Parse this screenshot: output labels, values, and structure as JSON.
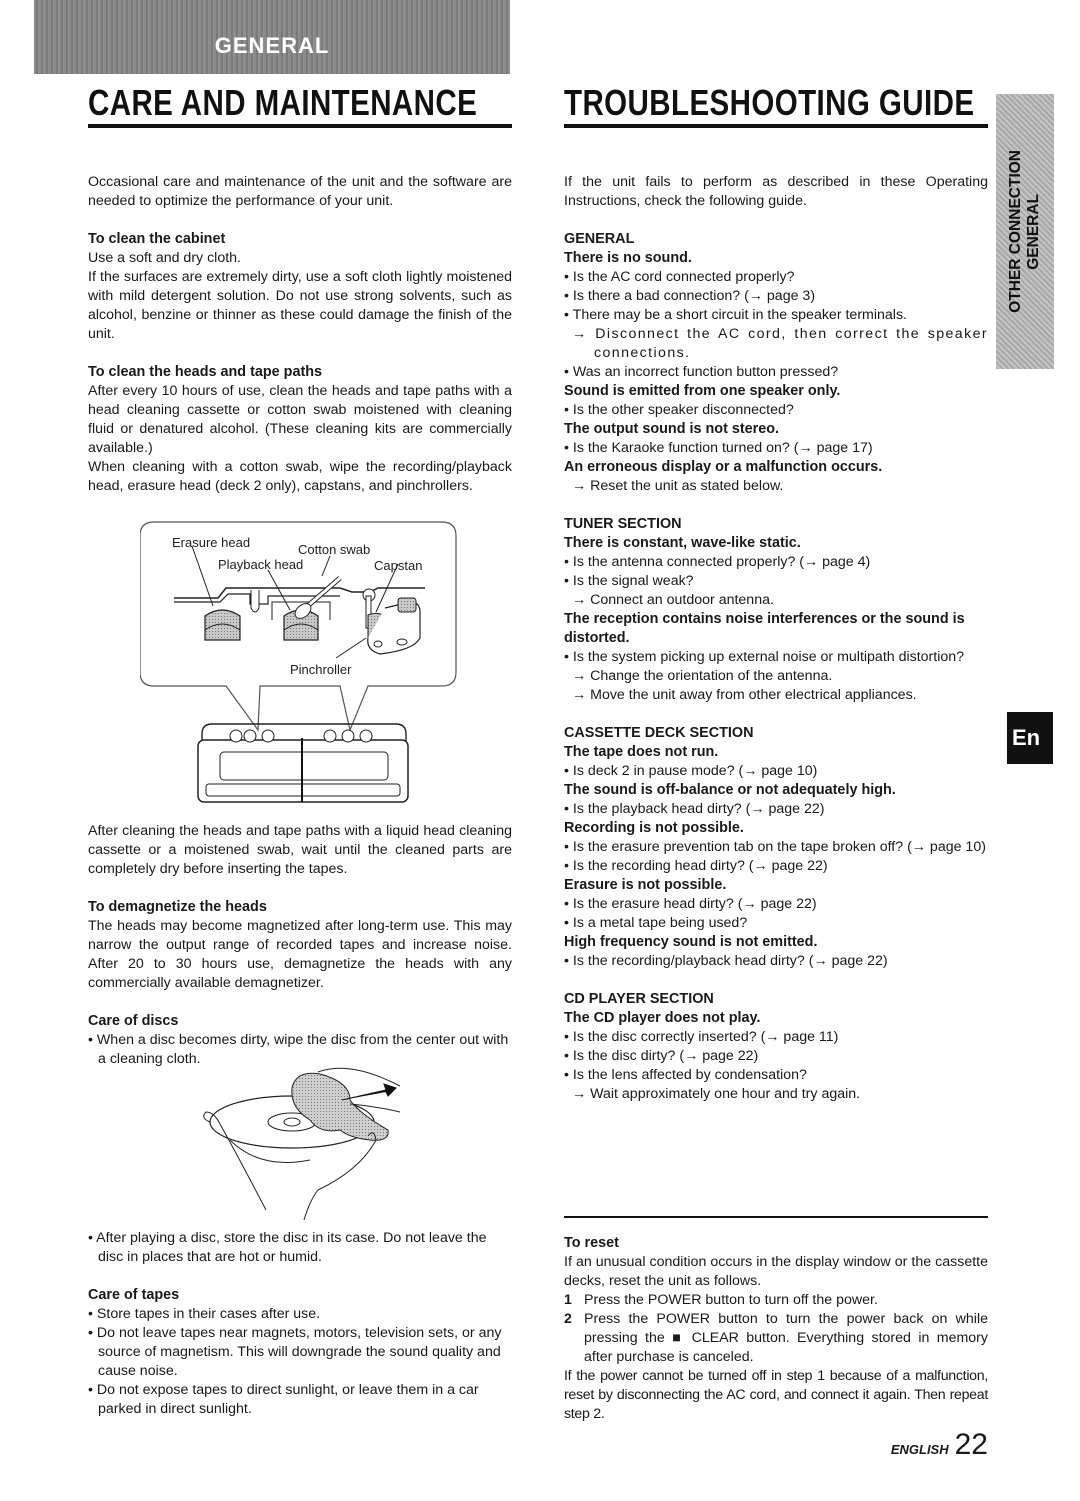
{
  "banner": {
    "label": "GENERAL"
  },
  "left": {
    "title": "CARE AND MAINTENANCE",
    "intro": "Occasional care and maintenance of the unit and the software are needed to optimize the performance of your unit.",
    "cabinet": {
      "heading": "To clean the cabinet",
      "p1": "Use a soft and dry cloth.",
      "p2": "If the surfaces are extremely dirty, use a soft cloth lightly moistened with mild detergent solution.  Do not use strong solvents, such as alcohol, benzine or thinner as these could damage the finish of the unit."
    },
    "heads": {
      "heading": "To clean the heads and tape paths",
      "p1": "After every 10 hours of use, clean the heads and tape paths with a head cleaning cassette or cotton swab moistened with cleaning fluid or denatured alcohol. (These cleaning kits are commercially available.)",
      "p2": "When cleaning with a cotton swab, wipe the recording/playback head, erasure head (deck 2 only), capstans, and pinchrollers."
    },
    "diagram": {
      "labels": {
        "erasure_head": "Erasure head",
        "cotton_swab": "Cotton swab",
        "playback_head": "Playback head",
        "capstan": "Capstan",
        "pinchroller": "Pinchroller"
      }
    },
    "after_cleaning": "After cleaning the heads and tape paths with a liquid head cleaning cassette or a moistened swab, wait until the cleaned parts are completely dry before inserting the tapes.",
    "demagnetize": {
      "heading": "To demagnetize the heads",
      "p1": "The heads may become magnetized after long-term use.  This may narrow the output range of recorded tapes and increase noise.  After 20 to 30 hours use, demagnetize the heads with any commercially available demagnetizer."
    },
    "discs": {
      "heading": "Care of discs",
      "items": [
        "• When a disc becomes dirty, wipe the disc from the center out with a cleaning cloth.",
        "• After playing a disc, store the disc in its case. Do not leave the disc in places that are hot or humid."
      ]
    },
    "tapes": {
      "heading": "Care of tapes",
      "items": [
        "• Store tapes in their cases after use.",
        "• Do not leave tapes near magnets, motors, television sets, or any source of magnetism. This will downgrade the sound quality and cause noise.",
        "• Do not expose tapes to direct sunlight, or leave them in a car parked in direct sunlight."
      ]
    }
  },
  "right": {
    "title": "TROUBLESHOOTING GUIDE",
    "intro": "If the unit fails to perform as described in these Operating Instructions, check the following guide.",
    "general": {
      "section": "GENERAL",
      "no_sound": {
        "heading": "There is no sound.",
        "b1": "• Is the AC cord connected properly?",
        "b2": "• Is there a bad connection? (→ page 3)",
        "b3": "• There may be a short circuit in the speaker terminals.",
        "a1": "→ Disconnect the AC cord, then correct the speaker connections.",
        "b4": "• Was an incorrect function button pressed?"
      },
      "one_speaker": {
        "heading": "Sound is emitted from one speaker only.",
        "b1": "• Is the other speaker disconnected?"
      },
      "not_stereo": {
        "heading": "The output sound is not stereo.",
        "b1": "• Is the Karaoke function turned on? (→ page 17)"
      },
      "erroneous": {
        "heading": "An erroneous display or a malfunction occurs.",
        "a1": "→ Reset the unit as stated below."
      }
    },
    "tuner": {
      "section": "TUNER SECTION",
      "static": {
        "heading": "There is constant, wave-like static.",
        "b1": "• Is the antenna connected properly? (→ page 4)",
        "b2": "• Is the signal weak?",
        "a1": "→ Connect an outdoor antenna."
      },
      "noise": {
        "heading": "The reception contains noise interferences or the sound is distorted.",
        "b1": "• Is the system picking up external noise or multipath distortion?",
        "a1": "→ Change the orientation of the antenna.",
        "a2": "→ Move the unit away from other electrical appliances."
      }
    },
    "cassette": {
      "section": "CASSETTE DECK SECTION",
      "not_run": {
        "heading": "The tape does not run.",
        "b1": "• Is deck 2 in pause mode? (→ page 10)"
      },
      "off_balance": {
        "heading": "The sound is off-balance or not adequately high.",
        "b1": "• Is the playback head dirty? (→ page 22)"
      },
      "recording": {
        "heading": "Recording is not possible.",
        "b1": "• Is the erasure prevention tab on the tape broken off? (→ page 10)",
        "b2": "• Is the recording head dirty? (→ page 22)"
      },
      "erasure": {
        "heading": "Erasure is not possible.",
        "b1": "• Is the erasure head dirty? (→ page 22)",
        "b2": "• Is a metal tape being used?"
      },
      "high_freq": {
        "heading": "High frequency sound is not emitted.",
        "b1": "• Is the recording/playback head dirty? (→ page 22)"
      }
    },
    "cd": {
      "section": "CD PLAYER SECTION",
      "not_play": {
        "heading": "The CD player does not play.",
        "b1": "• Is the disc correctly inserted? (→ page 11)",
        "b2": "• Is the disc dirty? (→ page 22)",
        "b3": "• Is the lens affected by condensation?",
        "a1": "→ Wait approximately one hour and try again."
      }
    },
    "reset": {
      "heading": "To reset",
      "intro": "If an unusual condition occurs in the display window or the cassette decks, reset the unit as follows.",
      "steps": [
        {
          "n": "1",
          "text": "Press the POWER button to turn off the power."
        },
        {
          "n": "2",
          "text": "Press the POWER button to turn the power back on while pressing the ■ CLEAR button. Everything stored in memory after purchase is canceled."
        }
      ],
      "note": "If the power cannot be turned off in step 1 because of a malfunction, reset by disconnecting the AC cord, and connect it again. Then repeat step 2."
    }
  },
  "side_tab": {
    "line1": "OTHER CONNECTION",
    "line2": "GENERAL"
  },
  "language_tab": {
    "label": "En"
  },
  "footer": {
    "language": "ENGLISH",
    "page": "22"
  }
}
